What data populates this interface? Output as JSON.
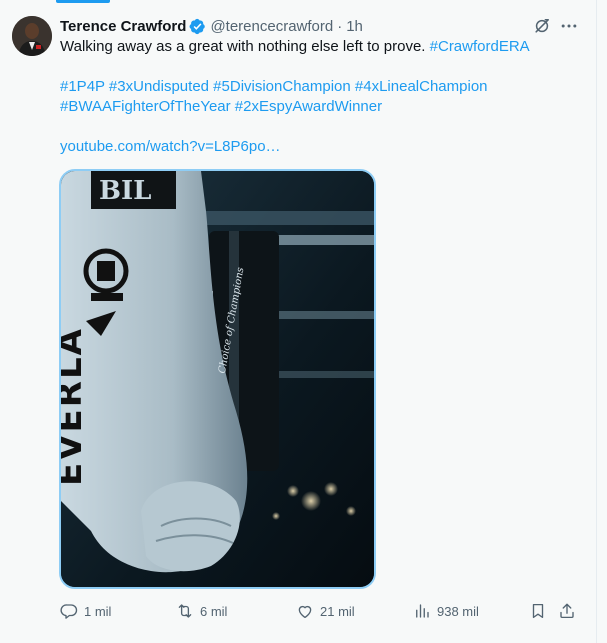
{
  "tweet": {
    "author_name": "Terence Crawford",
    "handle": "@terencecrawford",
    "separator": "·",
    "time": "1h",
    "text_line1_plain": "Walking away as a great with nothing else left to prove. ",
    "text_line1_hashtag": "#CrawfordERA",
    "hashtags_line1": "#1P4P #3xUndisputed #5DivisionChampion #4xLinealChampion",
    "hashtags_line2": "#BWAAFighterOfTheYear #2xEspyAwardWinner",
    "link": "youtube.com/watch?v=L8P6po…",
    "media_glove_text_top": "BIL",
    "media_glove_text_side": "EVERLA",
    "media_glove_script": "Choice of Champions"
  },
  "actions": {
    "replies": "1 mil",
    "reposts": "6 mil",
    "likes": "21 mil",
    "views": "938 mil"
  },
  "colors": {
    "accent": "#1d9bf0",
    "secondary_text": "#536471",
    "primary_text": "#0f1419",
    "background": "#f7f9f9"
  },
  "icons": [
    "verified-badge-icon",
    "grok-icon",
    "more-icon",
    "reply-icon",
    "repost-icon",
    "like-icon",
    "views-icon",
    "bookmark-icon",
    "share-icon"
  ]
}
